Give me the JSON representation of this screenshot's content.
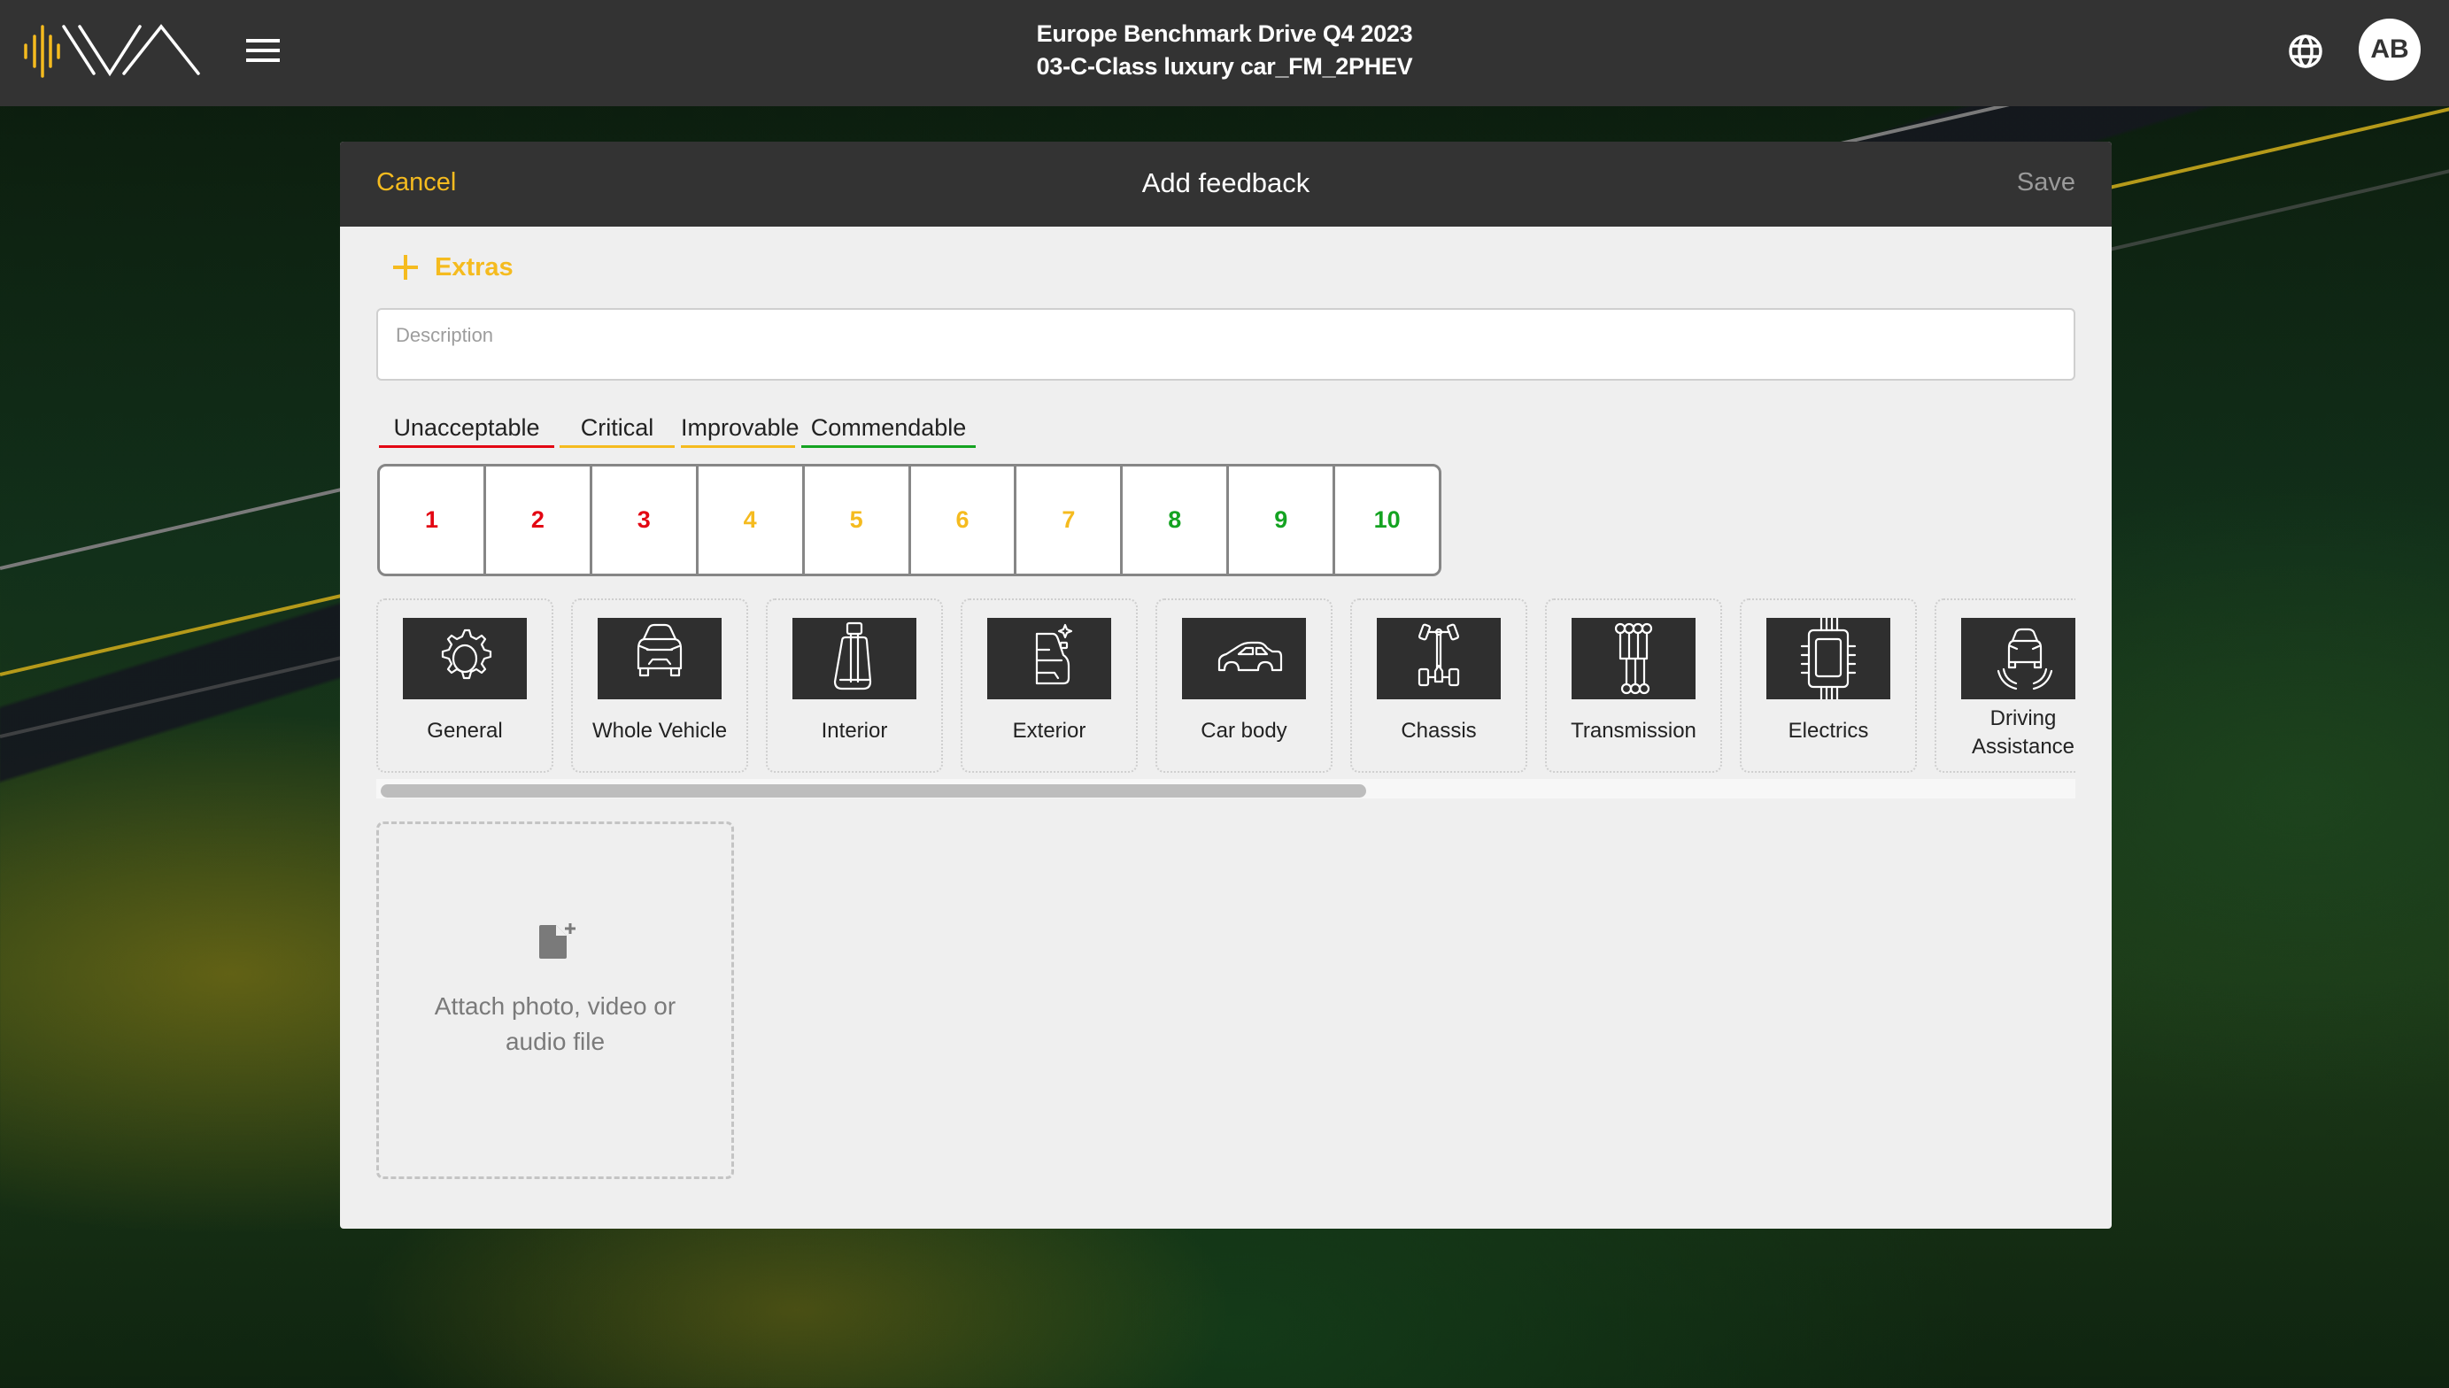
{
  "app": {
    "logo": "iva-logo",
    "menu_icon": "hamburger-menu-icon",
    "title_line1": "Europe Benchmark Drive Q4 2023",
    "title_line2": "03-C-Class luxury car_FM_2PHEV",
    "language_icon": "globe-icon",
    "user_initials": "AB"
  },
  "dialog": {
    "title": "Add feedback",
    "cancel_label": "Cancel",
    "save_label": "Save",
    "extras_label": "Extras",
    "description_placeholder": "Description",
    "description_value": "",
    "rating_groups": [
      {
        "label": "Unacceptable",
        "color": "#e30613",
        "from": 1,
        "to": 3
      },
      {
        "label": "Critical",
        "color": "#f5bb1f",
        "from": 4,
        "to": 5
      },
      {
        "label": "Improvable",
        "color": "#f5bb1f",
        "from": 6,
        "to": 7
      },
      {
        "label": "Commendable",
        "color": "#14a321",
        "from": 8,
        "to": 10
      }
    ],
    "ratings": [
      {
        "value": "1",
        "color": "#e30613"
      },
      {
        "value": "2",
        "color": "#e30613"
      },
      {
        "value": "3",
        "color": "#e30613"
      },
      {
        "value": "4",
        "color": "#f5bb1f"
      },
      {
        "value": "5",
        "color": "#f5bb1f"
      },
      {
        "value": "6",
        "color": "#f5bb1f"
      },
      {
        "value": "7",
        "color": "#f5bb1f"
      },
      {
        "value": "8",
        "color": "#14a321"
      },
      {
        "value": "9",
        "color": "#14a321"
      },
      {
        "value": "10",
        "color": "#14a321"
      }
    ],
    "categories": [
      {
        "label": "General",
        "icon": "gear-icon"
      },
      {
        "label": "Whole Vehicle",
        "icon": "car-front-icon"
      },
      {
        "label": "Interior",
        "icon": "car-seat-icon"
      },
      {
        "label": "Exterior",
        "icon": "car-exterior-shine-icon"
      },
      {
        "label": "Car body",
        "icon": "car-side-icon"
      },
      {
        "label": "Chassis",
        "icon": "chassis-axle-icon"
      },
      {
        "label": "Transmission",
        "icon": "gear-shift-icon"
      },
      {
        "label": "Electrics",
        "icon": "chip-icon"
      },
      {
        "label": "Driving Assistance",
        "icon": "car-sensor-icon"
      }
    ],
    "categories_scroll_fraction": 0.58,
    "attach_label": "Attach photo, video or audio file",
    "attach_icon": "file-add-icon"
  },
  "colors": {
    "accent": "#f5bb1f",
    "header_bg": "#333333",
    "dialog_bg": "#efefef"
  }
}
